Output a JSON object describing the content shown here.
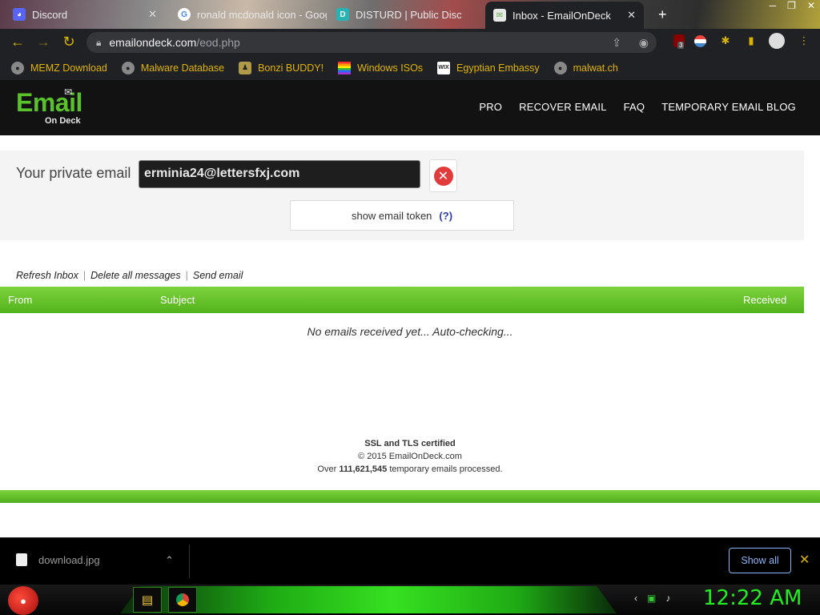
{
  "browser": {
    "tabs": [
      {
        "title": "Discord",
        "favicon": "discord-icon",
        "color": "#5865F2"
      },
      {
        "title": "ronald mcdonald icon - Google Search",
        "favicon": "google-icon",
        "color": "#4285F4"
      },
      {
        "title": "DISTURD | Public Disc",
        "favicon": "disboard-icon",
        "color": "#27b3b3"
      },
      {
        "title": "Inbox - EmailOnDeck",
        "favicon": "emailondeck-icon",
        "color": "#6ab04c"
      }
    ],
    "url_host": "emailondeck.com",
    "url_path": "/eod.php",
    "extension_badge": "3",
    "bookmarks": [
      {
        "label": "MEMZ Download",
        "icon": "globe-icon"
      },
      {
        "label": "Malware Database",
        "icon": "globe-icon"
      },
      {
        "label": "Bonzi BUDDY!",
        "icon": "bonzi-icon"
      },
      {
        "label": "Windows ISOs",
        "icon": "rainbow-flag-icon"
      },
      {
        "label": "Egyptian Embassy",
        "icon": "wix-icon"
      },
      {
        "label": "malwat.ch",
        "icon": "globe-icon"
      }
    ]
  },
  "site": {
    "logo_main": "Email",
    "logo_sub": "On Deck",
    "nav": [
      "PRO",
      "RECOVER EMAIL",
      "FAQ",
      "TEMPORARY EMAIL BLOG"
    ]
  },
  "email": {
    "label": "Your private email",
    "address": "erminia24@lettersfxj.com",
    "token_button": "show email token",
    "token_help": "(?)"
  },
  "inbox": {
    "actions": [
      "Refresh Inbox",
      "Delete all messages",
      "Send email"
    ],
    "columns": [
      "From",
      "Subject",
      "Received"
    ],
    "empty_message": "No emails received yet... Auto-checking..."
  },
  "footer": {
    "ssl": "SSL and TLS certified",
    "copyright": "© 2015 EmailOnDeck.com",
    "processed_prefix": "Over",
    "processed_count": "111,621,545",
    "processed_suffix": "temporary emails processed."
  },
  "downloads": {
    "filename": "download.jpg",
    "show_all": "Show all"
  },
  "taskbar": {
    "clock": "12:22 AM"
  },
  "colors": {
    "accent_green": "#59c12a",
    "header_bg": "#121212",
    "chrome_accent": "#d8b400"
  }
}
